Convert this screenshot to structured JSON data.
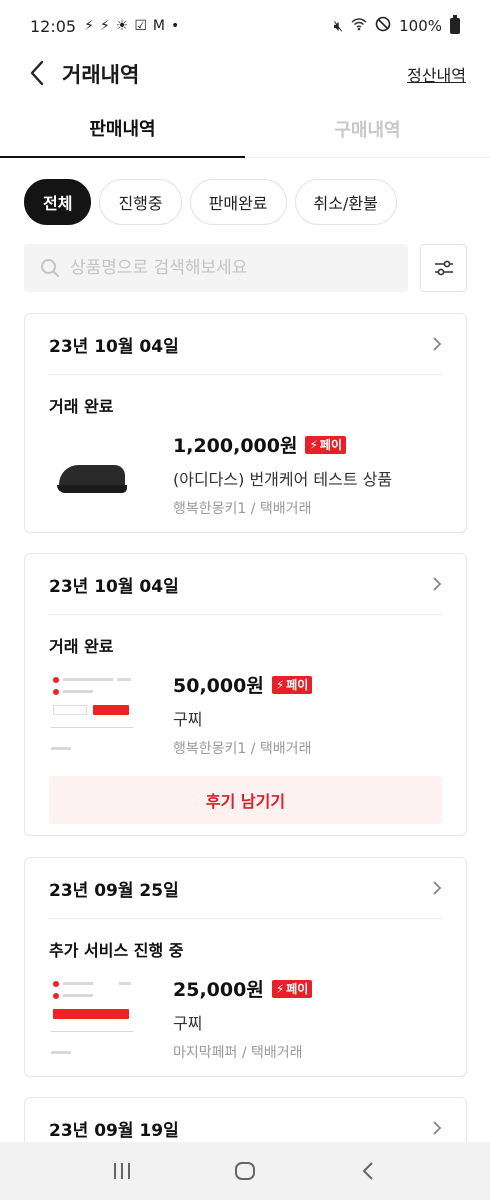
{
  "status_bar": {
    "time": "12:05",
    "battery": "100%"
  },
  "header": {
    "title": "거래내역",
    "settlement_link": "정산내역"
  },
  "tabs": [
    {
      "label": "판매내역",
      "active": true
    },
    {
      "label": "구매내역",
      "active": false
    }
  ],
  "filters": [
    {
      "label": "전체",
      "active": true
    },
    {
      "label": "진행중",
      "active": false
    },
    {
      "label": "판매완료",
      "active": false
    },
    {
      "label": "취소/환불",
      "active": false
    }
  ],
  "search": {
    "placeholder": "상품명으로 검색해보세요"
  },
  "pay_badge_label": "페이",
  "orders": [
    {
      "date": "23년 10월 04일",
      "status": "거래 완료",
      "price": "1,200,000원",
      "product": "(아디다스) 번개케어 테스트 상품",
      "seller": "행복한몽키1 / 택배거래"
    },
    {
      "date": "23년 10월 04일",
      "status": "거래 완료",
      "price": "50,000원",
      "product": "구찌",
      "seller": "행복한몽키1 / 택배거래",
      "action": "후기 남기기"
    },
    {
      "date": "23년 09월 25일",
      "status": "추가 서비스 진행 중",
      "price": "25,000원",
      "product": "구찌",
      "seller": "마지막페퍼 / 택배거래"
    },
    {
      "date": "23년 09월 19일"
    }
  ],
  "icons": {
    "back": "chevron-left-icon",
    "search": "search-icon",
    "filter": "sliders-icon",
    "chevron": "chevron-right-icon",
    "pay": "lightning-icon"
  },
  "colors": {
    "accent": "#e8202a",
    "review_bg": "#fdf1f1",
    "active_chip": "#141414"
  }
}
